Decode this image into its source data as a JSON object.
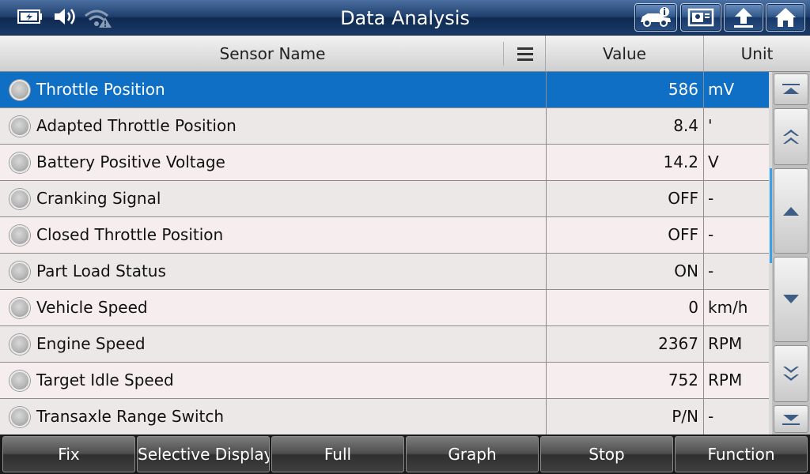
{
  "title_bar": {
    "title": "Data Analysis",
    "status_icons": [
      "battery-charging-icon",
      "volume-icon",
      "wifi-warning-icon"
    ],
    "buttons": [
      "vehicle-info-icon",
      "report-icon",
      "back-up-icon",
      "home-icon"
    ]
  },
  "table": {
    "headers": {
      "sensor": "Sensor Name",
      "value": "Value",
      "unit": "Unit"
    },
    "rows": [
      {
        "name": "Throttle Position",
        "value": "586",
        "unit": "mV",
        "selected": true
      },
      {
        "name": "Adapted Throttle Position",
        "value": "8.4",
        "unit": "'"
      },
      {
        "name": "Battery Positive Voltage",
        "value": "14.2",
        "unit": "V"
      },
      {
        "name": "Cranking Signal",
        "value": "OFF",
        "unit": "-"
      },
      {
        "name": "Closed Throttle Position",
        "value": "OFF",
        "unit": "-"
      },
      {
        "name": "Part Load Status",
        "value": "ON",
        "unit": "-"
      },
      {
        "name": "Vehicle Speed",
        "value": "0",
        "unit": "km/h"
      },
      {
        "name": "Engine Speed",
        "value": "2367",
        "unit": "RPM"
      },
      {
        "name": "Target Idle Speed",
        "value": "752",
        "unit": "RPM"
      },
      {
        "name": "Transaxle Range Switch",
        "value": "P/N",
        "unit": "-"
      }
    ]
  },
  "toolbar": {
    "fix": "Fix",
    "selective_display": "Selective Display",
    "full": "Full",
    "graph": "Graph",
    "stop": "Stop",
    "function": "Function"
  },
  "colors": {
    "selected_row": "#0f6fc4",
    "title_bar": "#1f3f6d",
    "scroll_thumb": "#3aa0e8"
  }
}
